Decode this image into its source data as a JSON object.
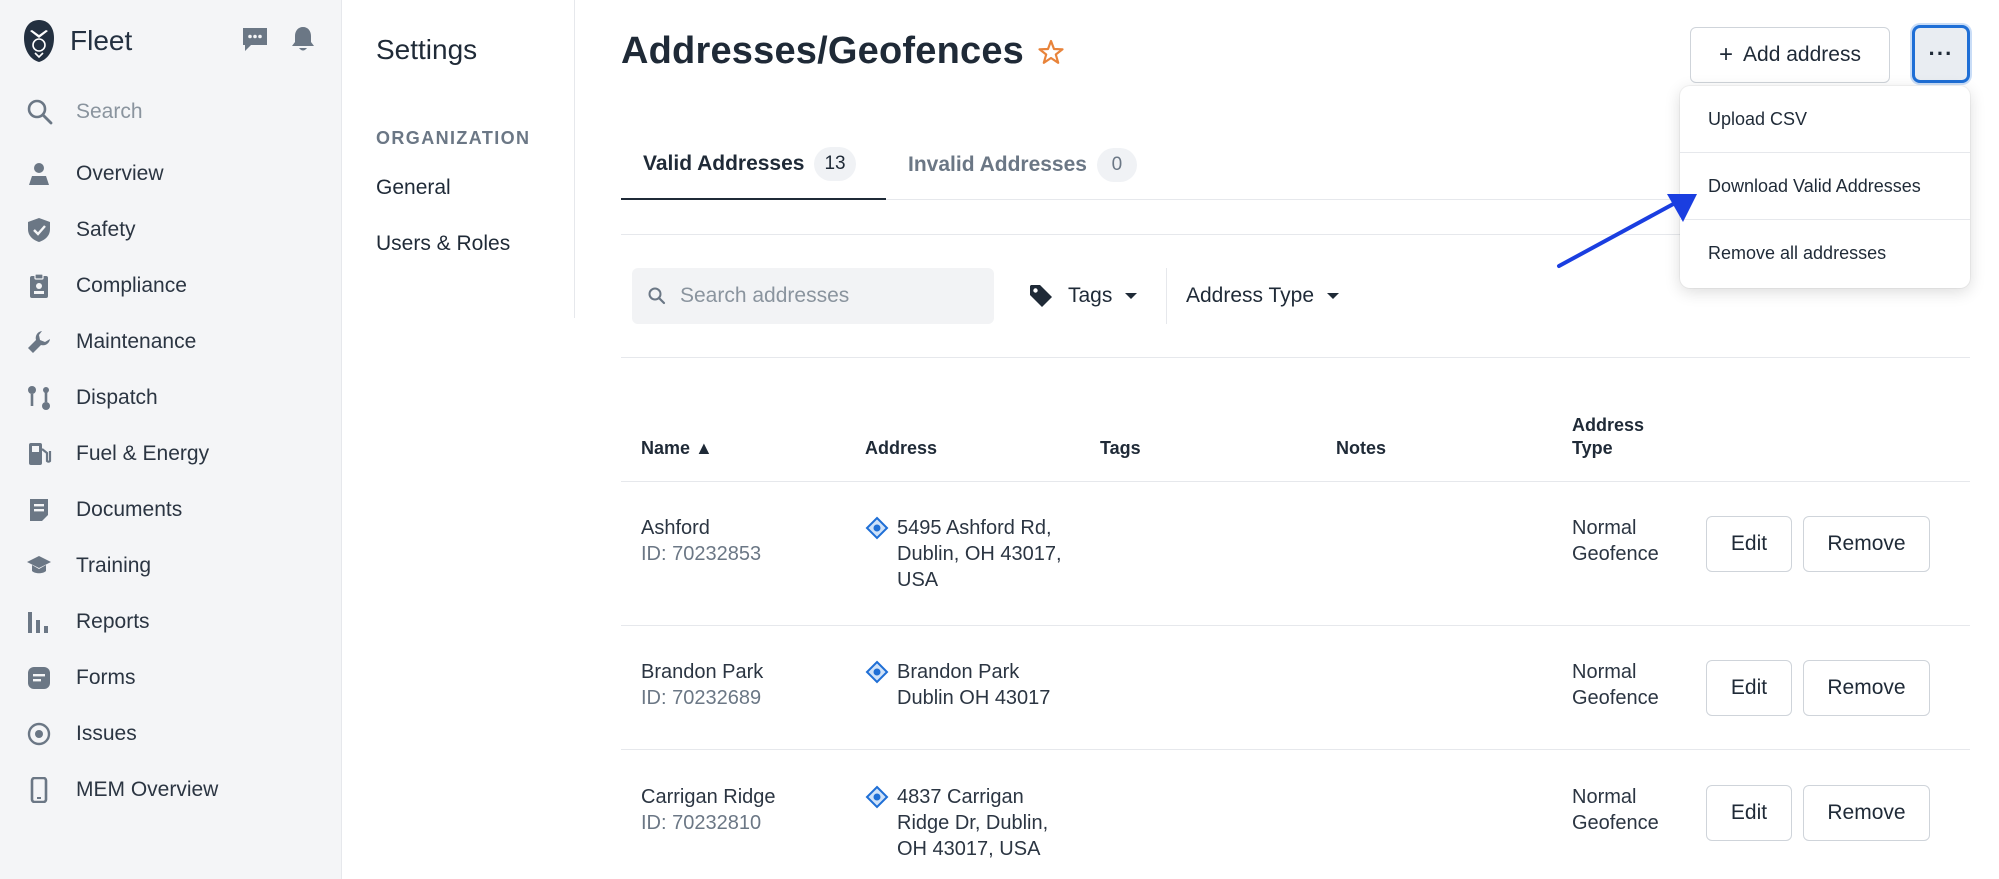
{
  "app": {
    "name": "Fleet"
  },
  "nav": {
    "search_label": "Search",
    "items": [
      {
        "label": "Overview",
        "icon": "map-pin-person-icon"
      },
      {
        "label": "Safety",
        "icon": "shield-check-icon"
      },
      {
        "label": "Compliance",
        "icon": "clipboard-icon"
      },
      {
        "label": "Maintenance",
        "icon": "wrench-icon"
      },
      {
        "label": "Dispatch",
        "icon": "route-icon"
      },
      {
        "label": "Fuel & Energy",
        "icon": "fuel-pump-icon"
      },
      {
        "label": "Documents",
        "icon": "document-icon"
      },
      {
        "label": "Training",
        "icon": "graduation-cap-icon"
      },
      {
        "label": "Reports",
        "icon": "bar-chart-icon"
      },
      {
        "label": "Forms",
        "icon": "form-icon"
      },
      {
        "label": "Issues",
        "icon": "issue-circle-icon"
      },
      {
        "label": "MEM Overview",
        "icon": "mobile-device-icon"
      }
    ]
  },
  "settings": {
    "title": "Settings",
    "section": "ORGANIZATION",
    "links": [
      "General",
      "Users & Roles"
    ]
  },
  "page": {
    "title": "Addresses/Geofences",
    "add_button": "Add address",
    "more_button": "···"
  },
  "tabs": [
    {
      "label": "Valid Addresses",
      "count": "13"
    },
    {
      "label": "Invalid Addresses",
      "count": "0"
    }
  ],
  "filters": {
    "search_placeholder": "Search addresses",
    "tags_label": "Tags",
    "address_type_label": "Address Type"
  },
  "table": {
    "headers": {
      "name": "Name ▲",
      "address": "Address",
      "tags": "Tags",
      "notes": "Notes",
      "address_type_1": "Address",
      "address_type_2": "Type"
    },
    "edit_label": "Edit",
    "remove_label": "Remove",
    "rows": [
      {
        "name": "Ashford",
        "id": "ID: 70232853",
        "address_lines": [
          "5495 Ashford Rd,",
          "Dublin, OH 43017,",
          "USA"
        ],
        "type_lines": [
          "Normal",
          "Geofence"
        ]
      },
      {
        "name": "Brandon Park",
        "id": "ID: 70232689",
        "address_lines": [
          "Brandon Park",
          "Dublin OH 43017",
          ""
        ],
        "type_lines": [
          "Normal",
          "Geofence"
        ]
      },
      {
        "name": "Carrigan Ridge",
        "id": "ID: 70232810",
        "address_lines": [
          "4837 Carrigan",
          "Ridge Dr, Dublin,",
          "OH 43017, USA"
        ],
        "type_lines": [
          "Normal",
          "Geofence"
        ]
      }
    ]
  },
  "menu": {
    "items": [
      "Upload CSV",
      "Download Valid Addresses",
      "Remove all addresses"
    ]
  },
  "colors": {
    "accent_blue": "#1f6fd6",
    "star_orange": "#e8833a",
    "annotation_arrow": "#1a3ee0"
  }
}
